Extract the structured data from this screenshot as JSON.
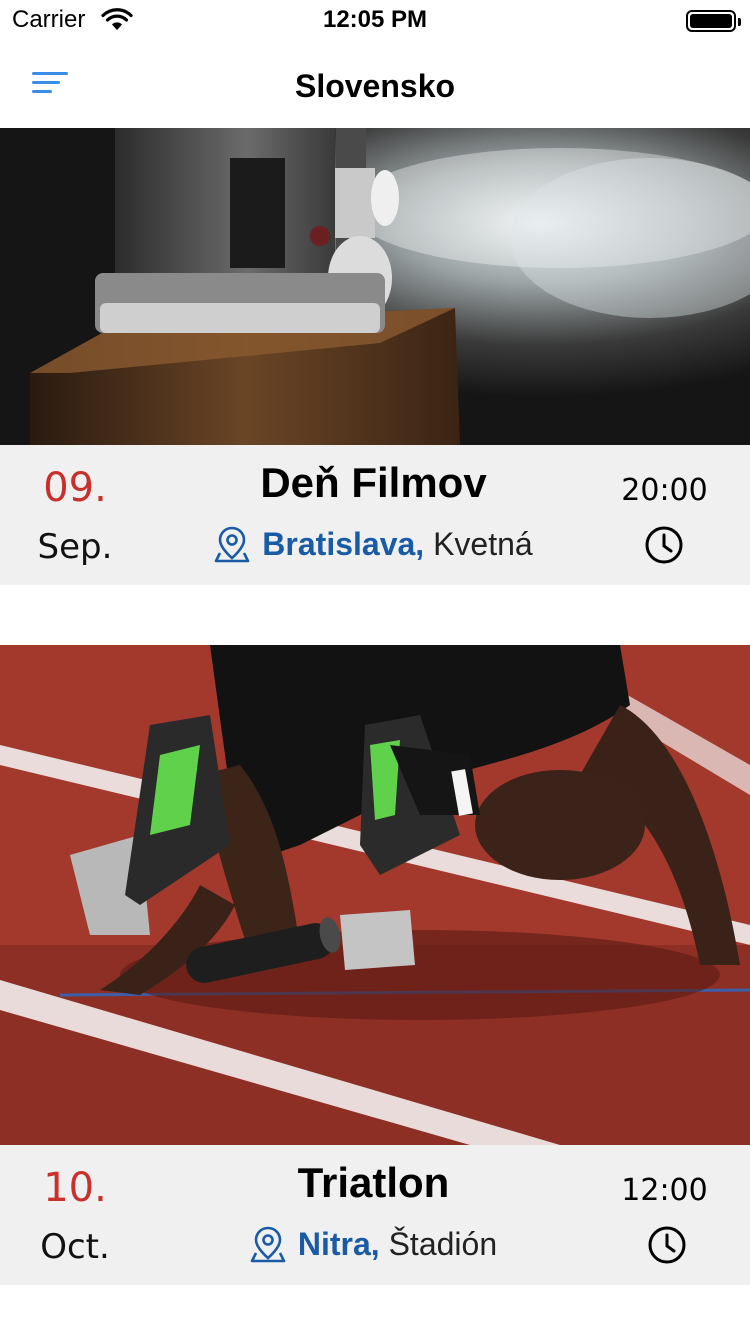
{
  "status_bar": {
    "carrier": "Carrier",
    "time": "12:05 PM",
    "icons": [
      "wifi-icon",
      "battery-icon"
    ]
  },
  "nav": {
    "title": "Slovensko",
    "menu_icon": "sort-menu-icon",
    "accent_color": "#3a8de8"
  },
  "events": [
    {
      "image": "film-projector-photo",
      "day": "09.",
      "month": "Sep.",
      "title": "Deň Filmov",
      "city": "Bratislava,",
      "place": "Kvetná",
      "time": "20:00"
    },
    {
      "image": "sprinter-starting-blocks-photo",
      "day": "10.",
      "month": "Oct.",
      "title": "Triatlon",
      "city": "Nitra,",
      "place": "Štadión",
      "time": "12:00"
    }
  ],
  "colors": {
    "date_red": "#c9302c",
    "city_blue": "#1a5ba6",
    "info_bar_bg": "#f0f0f0"
  }
}
